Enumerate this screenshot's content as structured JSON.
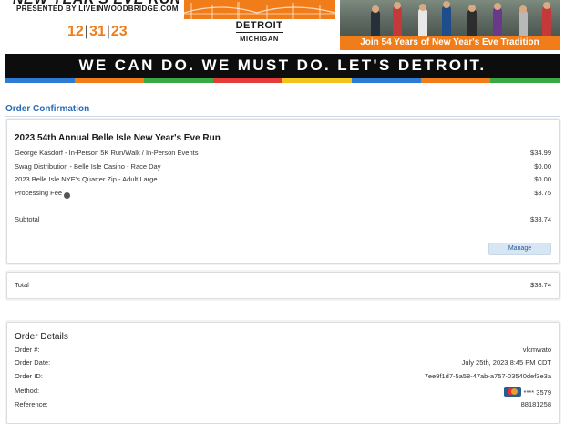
{
  "banner": {
    "race_title": "NEW YEAR'S EVE RUN",
    "presented_by": "PRESENTED BY LIVEINWOODBRIDGE.COM",
    "date_parts": [
      "12",
      "31",
      "23"
    ],
    "city": "DETROIT",
    "state": "MICHIGAN",
    "tagline": "Join 54 Years of New Year's Eve Tradition",
    "brand_orange": "#f07d1a"
  },
  "slogan": {
    "text": "WE CAN DO. WE MUST DO. LET'S DETROIT.",
    "stripe_colors": [
      "#2d7bd3",
      "#f07d1a",
      "#3aa845",
      "#e43b3b",
      "#f2c31b",
      "#2d7bd3",
      "#f07d1a",
      "#3aa845"
    ]
  },
  "page": {
    "title": "Order Confirmation",
    "accent": "#2a6ab5"
  },
  "order": {
    "event_title": "2023 54th Annual Belle Isle New Year's Eve Run",
    "items": [
      {
        "label": "George Kasdorf - In-Person 5K Run/Walk / In-Person Events",
        "price": "$34.99"
      },
      {
        "label": "Swag Distribution - Belle Isle Casino - Race Day",
        "price": "$0.00"
      },
      {
        "label": "2023 Belle Isle NYE's Quarter Zip - Adult Large",
        "price": "$0.00"
      },
      {
        "label": "Processing Fee",
        "price": "$3.75",
        "info_icon": "info-icon"
      }
    ],
    "subtotal_label": "Subtotal",
    "subtotal_value": "$38.74",
    "manage_label": "Manage",
    "total_label": "Total",
    "total_value": "$38.74"
  },
  "details": {
    "title": "Order Details",
    "rows": [
      {
        "label": "Order #:",
        "value": "vlcmwato"
      },
      {
        "label": "Order Date:",
        "value": "July 25th, 2023 8:45 PM CDT"
      },
      {
        "label": "Order ID:",
        "value": "7ee9f1d7-5a58-47ab-a757-03540def3e3a"
      },
      {
        "label": "Method:",
        "value": "**** 3579",
        "icon": "mastercard-icon"
      },
      {
        "label": "Reference:",
        "value": "88181258"
      }
    ]
  }
}
